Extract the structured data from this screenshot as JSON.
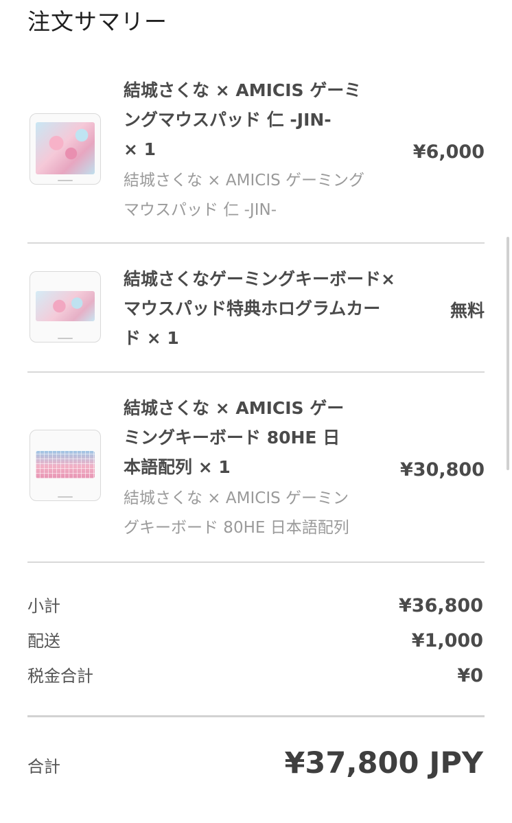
{
  "page": {
    "title": "注文サマリー"
  },
  "items": [
    {
      "title_lines": [
        "結城さくな × AMICIS ゲーミ",
        "ングマウスパッド 仁 -JIN-",
        "× 1"
      ],
      "variant_lines": [
        "結城さくな × AMICIS ゲーミング",
        "マウスパッド 仁 -JIN-"
      ],
      "price": "¥6,000",
      "thumbnail": "mousepad-image"
    },
    {
      "title_lines": [
        "結城さくなゲーミングキーボード×",
        "マウスパッド特典ホログラムカー",
        "ド × 1"
      ],
      "variant_lines": [],
      "price": "無料",
      "thumbnail": "hologram-card-image"
    },
    {
      "title_lines": [
        "結城さくな × AMICIS ゲー",
        "ミングキーボード 80HE 日",
        "本語配列 × 1"
      ],
      "variant_lines": [
        "結城さくな × AMICIS ゲーミン",
        "グキーボード 80HE 日本語配列"
      ],
      "price": "¥30,800",
      "thumbnail": "keyboard-image"
    }
  ],
  "summary": {
    "subtotal_label": "小計",
    "subtotal_value": "¥36,800",
    "shipping_label": "配送",
    "shipping_value": "¥1,000",
    "tax_label": "税金合計",
    "tax_value": "¥0"
  },
  "total": {
    "label": "合計",
    "value": "¥37,800 JPY"
  }
}
